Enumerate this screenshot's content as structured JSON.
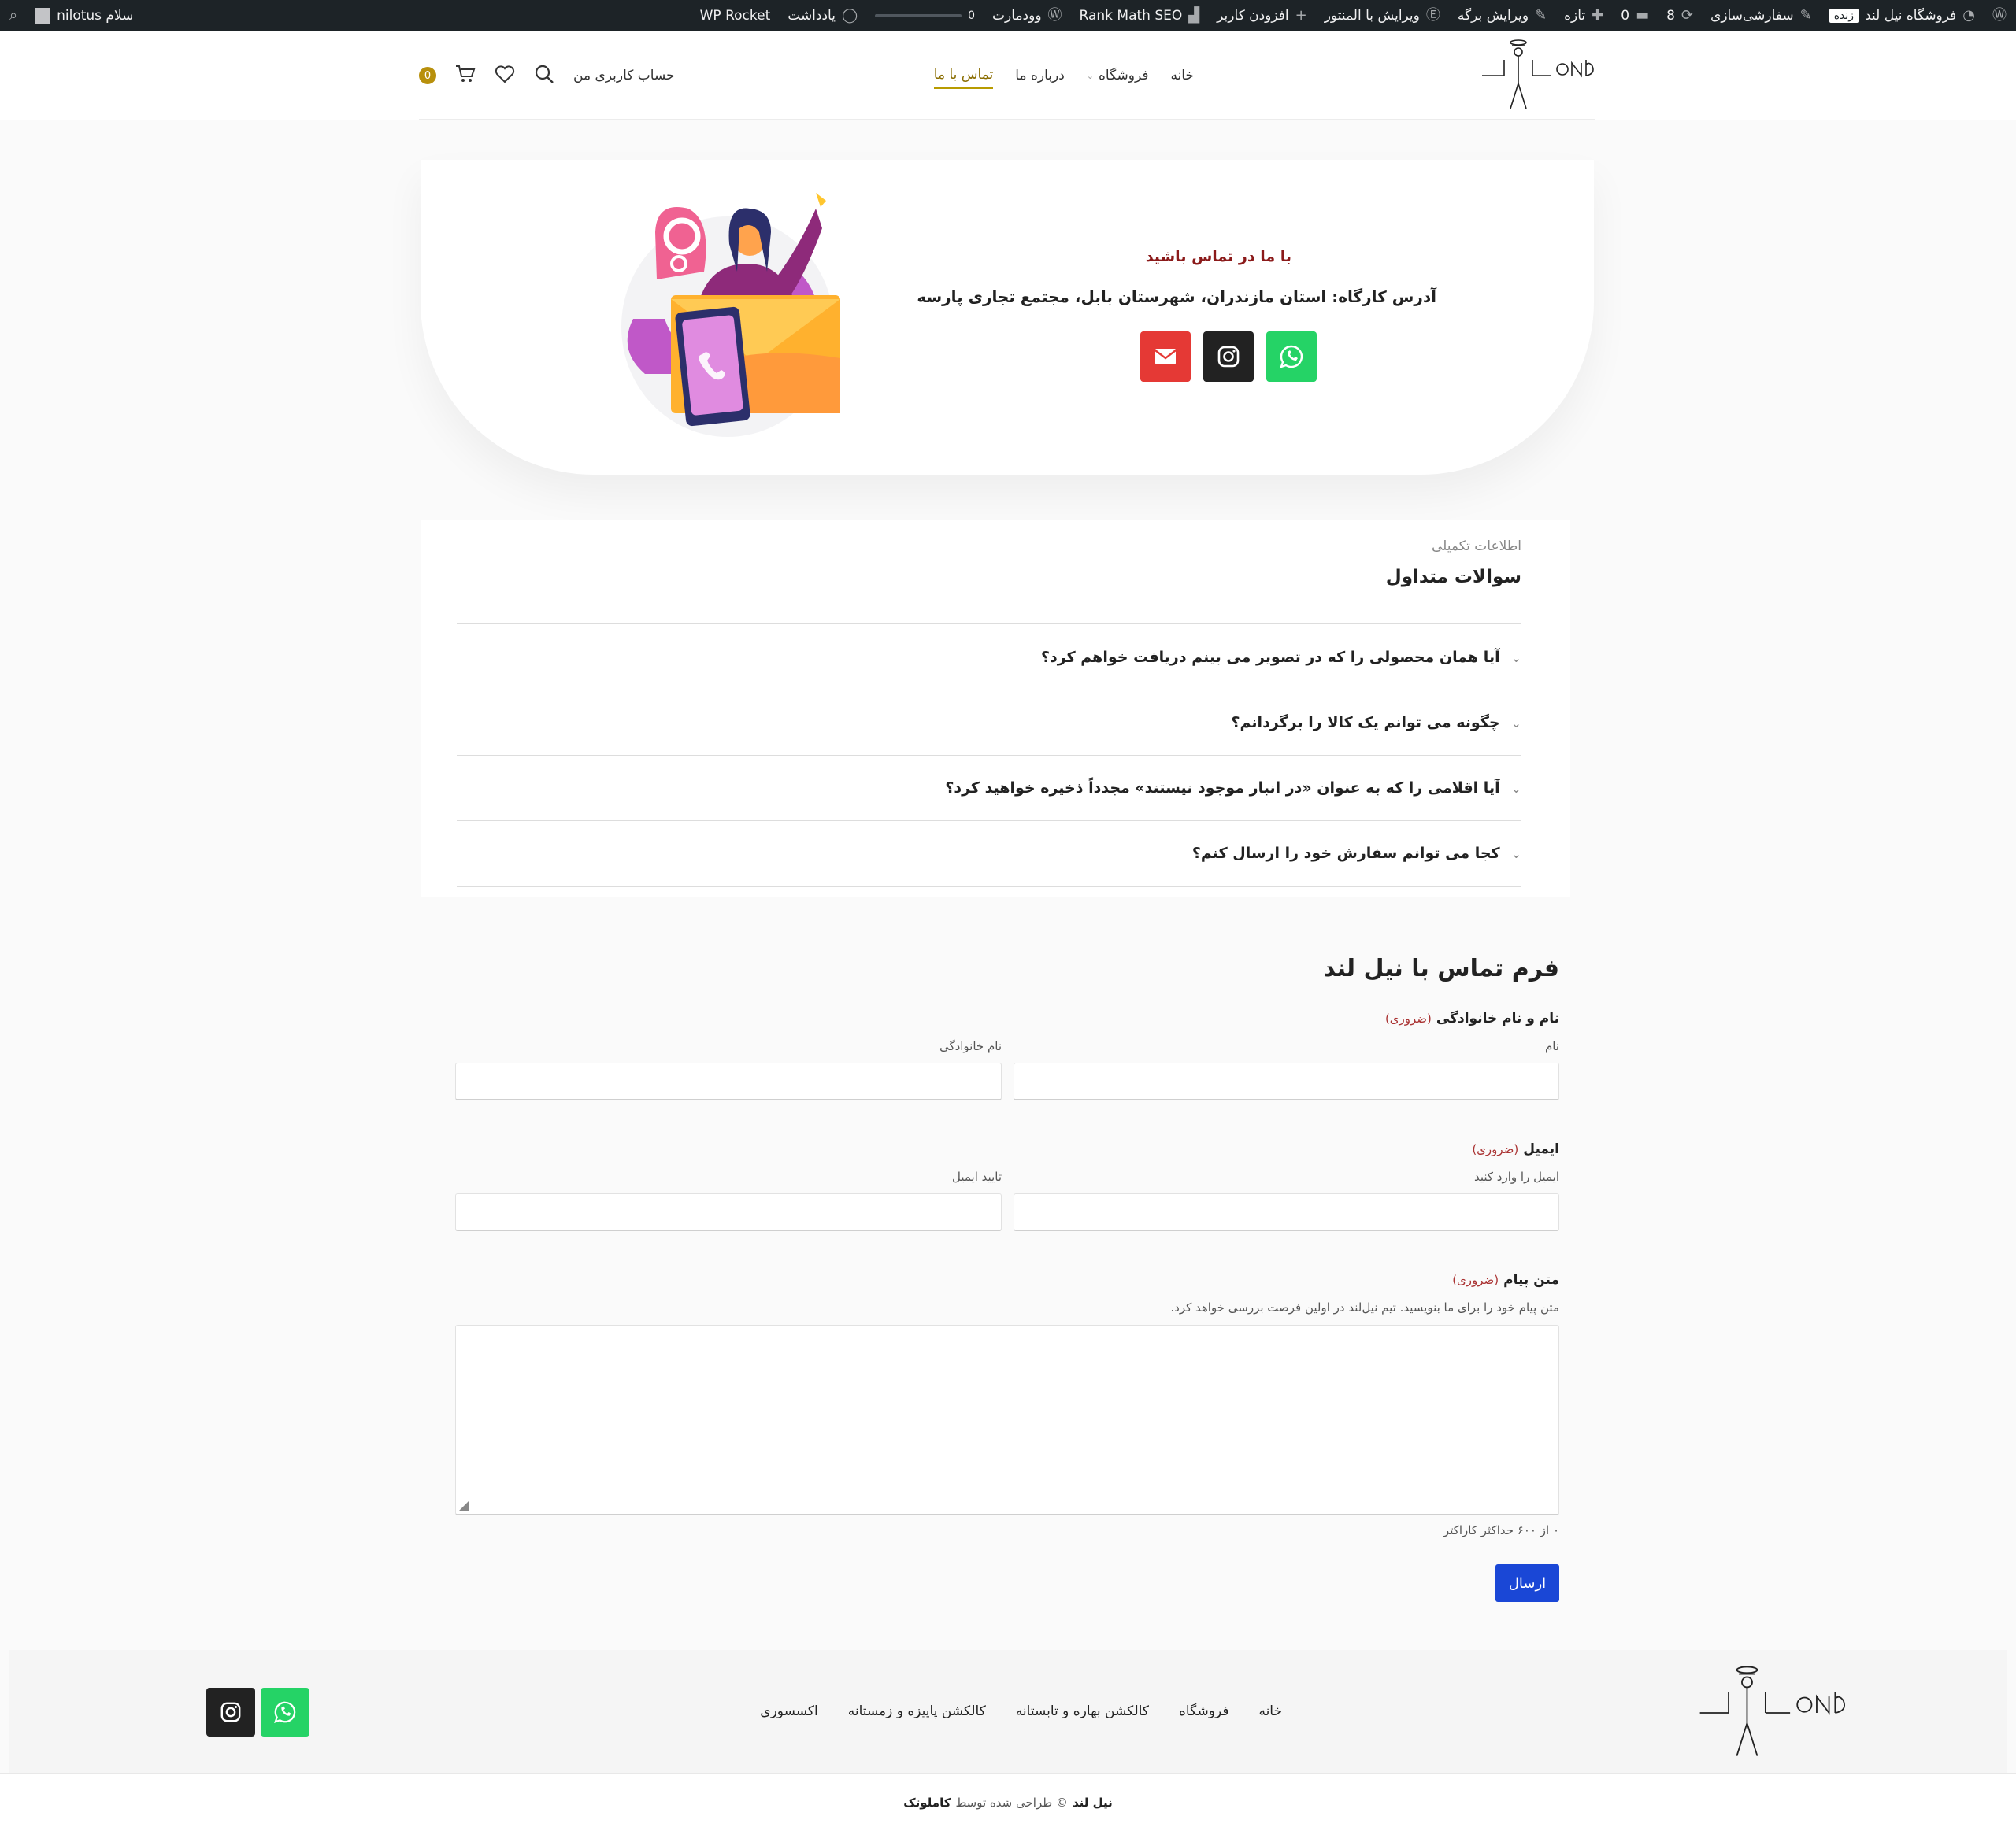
{
  "admin_bar": {
    "site_name": "فروشگاه نیل لند",
    "live_badge": "زنده",
    "customize": "سفارشی‌سازی",
    "updates_count": "8",
    "comments_count": "0",
    "new": "تازه",
    "edit_page": "ویرایش برگه",
    "edit_elementor": "ویرایش با المنتور",
    "add_user": "افزودن کاربر",
    "rank_math": "Rank Math SEO",
    "woodmart": "وودمارت",
    "notes_count": "0",
    "notes": "یادداشت",
    "wp_rocket": "WP Rocket",
    "greeting": "سلام nilotus"
  },
  "header": {
    "nav": [
      {
        "label": "خانه"
      },
      {
        "label": "فروشگاه"
      },
      {
        "label": "درباره ما"
      },
      {
        "label": "تماس با ما"
      }
    ],
    "account": "حساب کاربری من",
    "cart_count": "0"
  },
  "hero": {
    "title": "با ما در تماس باشید",
    "address": "آدرس کارگاه: استان مازندران، شهرستان بابل، مجتمع تجاری پارسه",
    "colors": {
      "whatsapp": "#25d366",
      "instagram": "#222222",
      "email": "#e53935"
    }
  },
  "faq": {
    "subtitle": "اطلاعات تکمیلی",
    "title": "سوالات متداول",
    "items": [
      "آیا همان محصولی را که در تصویر می بینم دریافت خواهم کرد؟",
      "چگونه می توانم یک کالا را برگردانم؟",
      "آیا اقلامی را که به عنوان «در انبار موجود نیستند» مجدداً ذخیره خواهید کرد؟",
      "کجا می توانم سفارش خود را ارسال کنم؟"
    ]
  },
  "form": {
    "title": "فرم تماس با نیل لند",
    "required": "(ضروری)",
    "name_label": "نام و نام خانوادگی",
    "first_name": "نام",
    "last_name": "نام خانوادگی",
    "email_label": "ایمیل",
    "email_enter": "ایمیل را وارد کنید",
    "email_confirm": "تایید ایمیل",
    "message_label": "متن پیام",
    "message_help": "متن پیام خود را برای ما بنویسید. تیم نیل‌لند در اولین فرصت بررسی خواهد کرد.",
    "counter": "۰ از ۶۰۰ حداکثر کاراکتر",
    "submit": "ارسال"
  },
  "footer": {
    "nav": [
      "خانه",
      "فروشگاه",
      "کالکشن بهاره و تابستانه",
      "کالکشن پاییزه و زمستانه",
      "اکسسوری"
    ],
    "copyright_brand": "نیل لند",
    "copyright_text": "© طراحی شده توسط",
    "designer": "کاملوتک"
  }
}
